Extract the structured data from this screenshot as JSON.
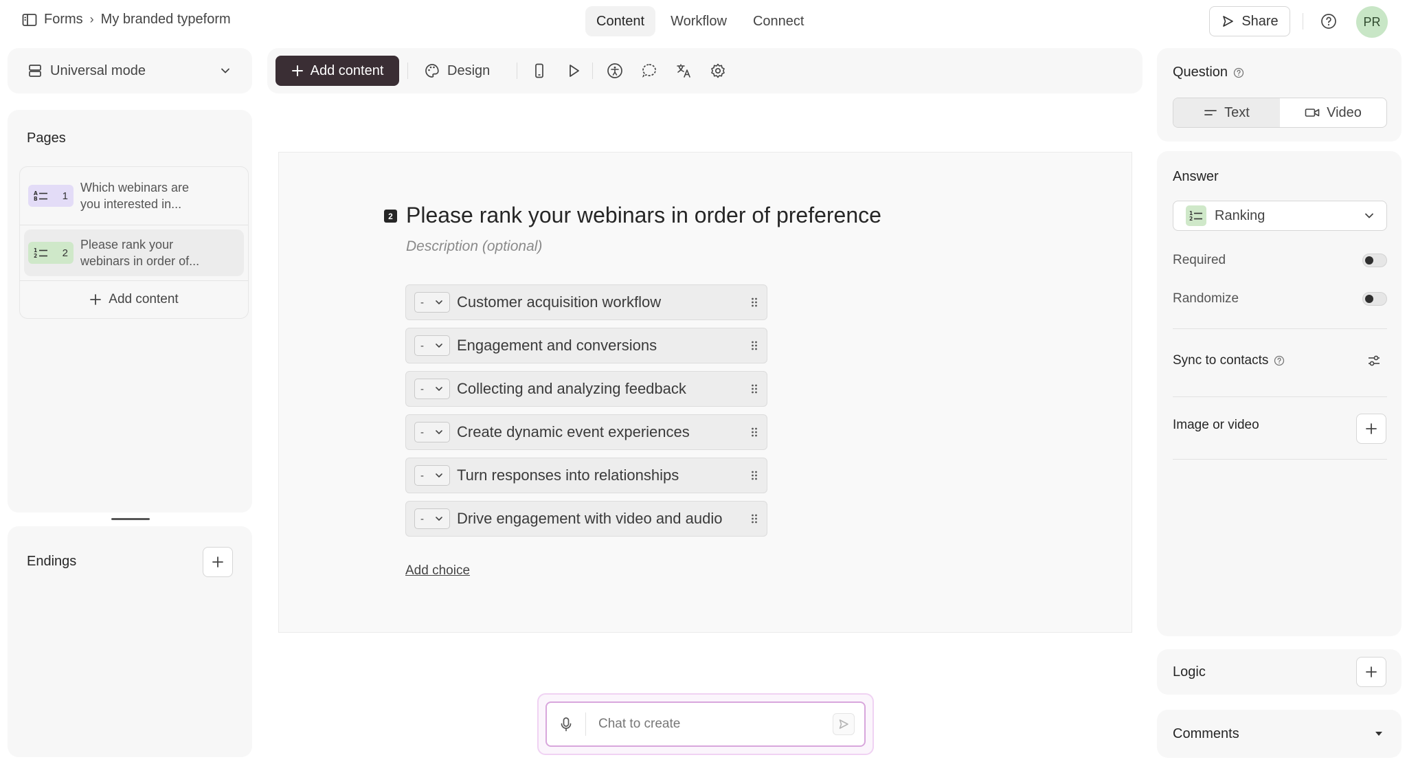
{
  "breadcrumb": {
    "root": "Forms",
    "separator": "›",
    "current": "My branded typeform"
  },
  "nav": {
    "tabs": [
      "Content",
      "Workflow",
      "Connect"
    ],
    "active": "Content"
  },
  "header": {
    "share_label": "Share",
    "avatar_initials": "PR"
  },
  "mode": {
    "label": "Universal mode"
  },
  "pages": {
    "title": "Pages",
    "items": [
      {
        "number": "1",
        "text_line1": "Which webinars are",
        "text_line2": "you interested in..."
      },
      {
        "number": "2",
        "text_line1": "Please rank your",
        "text_line2": "webinars in order of..."
      }
    ],
    "add_label": "Add content"
  },
  "endings": {
    "title": "Endings"
  },
  "toolbar": {
    "add_content_label": "Add content",
    "design_label": "Design"
  },
  "question": {
    "number": "2",
    "title": "Please rank your webinars in order of preference",
    "description_placeholder": "Description (optional)",
    "rank_placeholder": "-",
    "choices": [
      "Customer acquisition workflow",
      "Engagement and conversions",
      "Collecting and analyzing feedback",
      "Create dynamic event experiences",
      "Turn responses into relationships",
      "Drive engagement with video and audio"
    ],
    "add_choice_label": "Add choice"
  },
  "chat": {
    "placeholder": "Chat to create"
  },
  "right_panel": {
    "question_title": "Question",
    "question_modes": [
      "Text",
      "Video"
    ],
    "answer_title": "Answer",
    "answer_type": "Ranking",
    "required_label": "Required",
    "randomize_label": "Randomize",
    "sync_label": "Sync to contacts",
    "image_label": "Image or video",
    "logic_label": "Logic",
    "comments_label": "Comments"
  },
  "colors": {
    "primary_button": "#3a2e34",
    "avatar_bg": "#c8e6c6",
    "chat_border": "#d8a6dc",
    "ranking_badge": "#cfe8c9"
  }
}
